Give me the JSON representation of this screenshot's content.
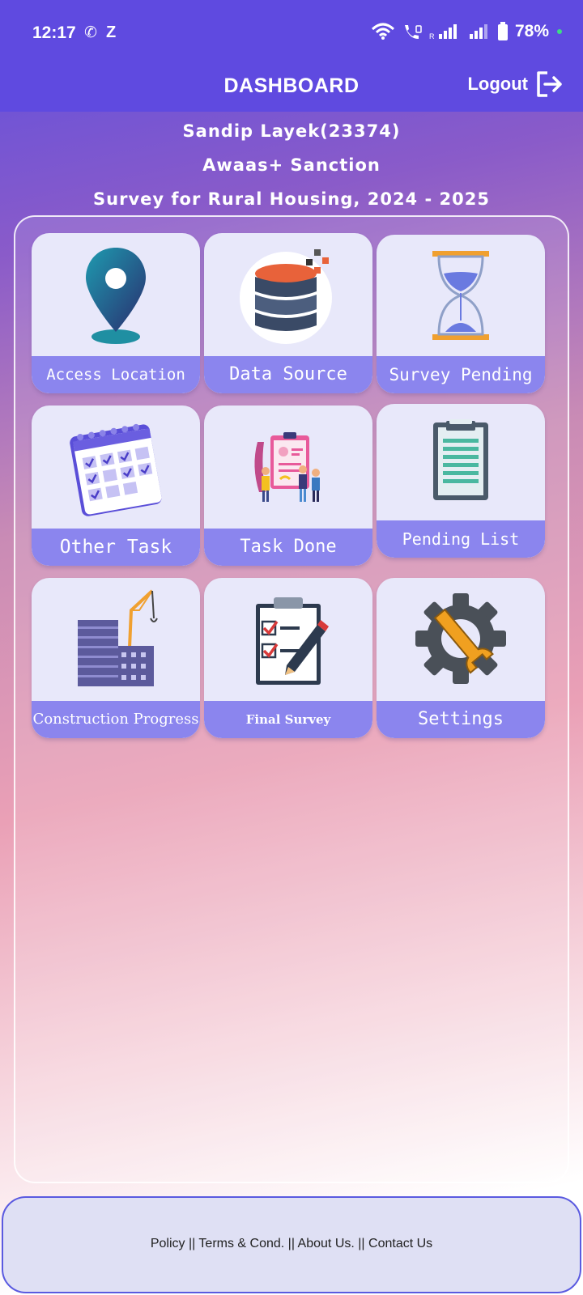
{
  "status_bar": {
    "time": "12:17",
    "z_indicator": "Z",
    "battery": "78%",
    "icons": [
      "phone-icon",
      "wifi-icon",
      "volte-call-icon",
      "signal-icon",
      "signal-icon",
      "battery-icon"
    ]
  },
  "app_bar": {
    "title": "DASHBOARD",
    "logout_label": "Logout",
    "background": "#5f4ae0"
  },
  "header": {
    "user": "Sandip Layek(23374)",
    "scheme": "Awaas+ Sanction",
    "survey": "Survey for Rural Housing, 2024 - 2025"
  },
  "tiles": [
    {
      "label": "Access Location",
      "icon": "location-pin-icon"
    },
    {
      "label": "Data Source",
      "icon": "database-icon"
    },
    {
      "label": "Survey Pending",
      "icon": "hourglass-icon"
    },
    {
      "label": "Other Task",
      "icon": "calendar-icon"
    },
    {
      "label": "Task Done",
      "icon": "team-clipboard-icon"
    },
    {
      "label": "Pending List",
      "icon": "clipboard-icon"
    },
    {
      "label": "Construction Progress",
      "icon": "construction-crane-icon"
    },
    {
      "label": "Final Survey",
      "icon": "checklist-pen-icon"
    },
    {
      "label": "Settings",
      "icon": "gear-wrench-icon"
    }
  ],
  "footer": {
    "text": "Policy ||  Terms & Cond. ||  About Us. ||  Contact Us"
  },
  "colors": {
    "accent": "#5f4ae0",
    "tile_label_bg": "#8b85ee",
    "tile_bg": "#e8e8fa"
  }
}
